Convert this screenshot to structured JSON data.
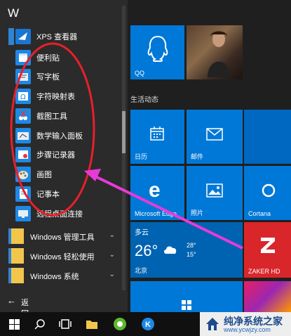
{
  "app_list": {
    "letter_header": "W",
    "items": [
      {
        "label": "XPS 查看器",
        "icon": "xps-viewer-icon",
        "color": "#1976d2"
      },
      {
        "label": "便利贴",
        "icon": "sticky-notes-icon",
        "color": "#1e88e5"
      },
      {
        "label": "写字板",
        "icon": "wordpad-icon",
        "color": "#1e88e5"
      },
      {
        "label": "字符映射表",
        "icon": "character-map-icon",
        "color": "#1e88e5"
      },
      {
        "label": "截图工具",
        "icon": "snipping-tool-icon",
        "color": "#1e88e5"
      },
      {
        "label": "数学输入面板",
        "icon": "math-input-panel-icon",
        "color": "#1e88e5"
      },
      {
        "label": "步骤记录器",
        "icon": "steps-recorder-icon",
        "color": "#1e88e5"
      },
      {
        "label": "画图",
        "icon": "paint-icon",
        "color": "#1e88e5"
      },
      {
        "label": "记事本",
        "icon": "notepad-icon",
        "color": "#1e88e5"
      },
      {
        "label": "远程桌面连接",
        "icon": "remote-desktop-icon",
        "color": "#1e88e5"
      }
    ],
    "folders": [
      {
        "label": "Windows 管理工具",
        "chevron": "⌄"
      },
      {
        "label": "Windows 轻松使用",
        "chevron": "⌄"
      },
      {
        "label": "Windows 系统",
        "chevron": "⌄"
      }
    ],
    "back_label": "返回"
  },
  "tiles": {
    "section_header": "生活动态",
    "qq_label": "QQ",
    "calendar_label": "日历",
    "mail_label": "邮件",
    "edge_label": "Microsoft Edge",
    "photos_label": "照片",
    "cortana_label": "Cortana",
    "weather": {
      "condition": "多云",
      "temp": "26°",
      "high": "28°",
      "low": "15°",
      "city": "北京"
    },
    "zaker_label": "ZAKER HD"
  },
  "watermark": {
    "title": "纯净系统之家",
    "subtitle": "www.ycwjzy.com"
  },
  "colors": {
    "tile_blue": "#0078d7",
    "annotation_red": "#e8202a",
    "annotation_magenta": "#e83ad9"
  }
}
